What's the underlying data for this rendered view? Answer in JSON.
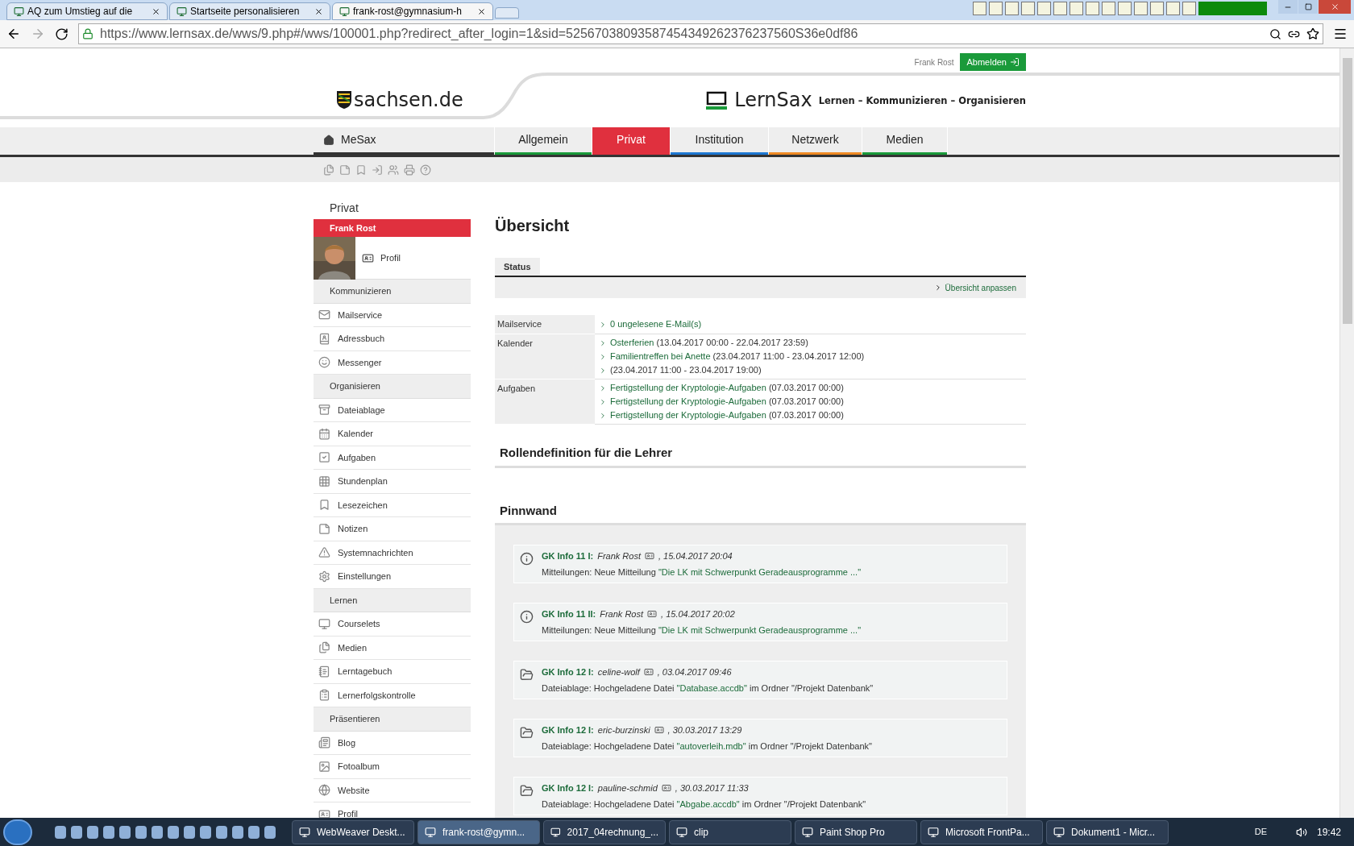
{
  "browser": {
    "tabs": [
      {
        "title": "AQ zum Umstieg auf die",
        "selected": false
      },
      {
        "title": "Startseite personalisieren",
        "selected": false
      },
      {
        "title": "frank-rost@gymnasium-h",
        "selected": true
      }
    ],
    "url": "https://www.lernsax.de/wws/9.php#/wws/100001.php?redirect_after_login=1&sid=52567038093587454349262376237560S36e0df86"
  },
  "header": {
    "user": "Frank Rost",
    "logout": "Abmelden",
    "state_logo": "sachsen.de",
    "brand": "LernSax",
    "slogan": "Lernen – Kommunizieren – Organisieren"
  },
  "nav": [
    {
      "label": "MeSax",
      "color": "#333333",
      "selected": false
    },
    {
      "label": "Allgemein",
      "color": "#1a9a3a",
      "selected": false
    },
    {
      "label": "Privat",
      "color": "#e0303e",
      "selected": true
    },
    {
      "label": "Institution",
      "color": "#1e78d2",
      "selected": false
    },
    {
      "label": "Netzwerk",
      "color": "#f08a24",
      "selected": false
    },
    {
      "label": "Medien",
      "color": "#1a9a3a",
      "selected": false
    }
  ],
  "sidebar": {
    "title": "Privat",
    "user": "Frank Rost",
    "profile": "Profil",
    "sections": [
      {
        "heading": "Kommunizieren",
        "items": [
          "Mailservice",
          "Adressbuch",
          "Messenger"
        ]
      },
      {
        "heading": "Organisieren",
        "items": [
          "Dateiablage",
          "Kalender",
          "Aufgaben",
          "Stundenplan",
          "Lesezeichen",
          "Notizen",
          "Systemnachrichten",
          "Einstellungen"
        ]
      },
      {
        "heading": "Lernen",
        "items": [
          "Courselets",
          "Medien",
          "Lerntagebuch",
          "Lernerfolgskontrolle"
        ]
      },
      {
        "heading": "Präsentieren",
        "items": [
          "Blog",
          "Fotoalbum",
          "Website",
          "Profil"
        ]
      }
    ]
  },
  "main": {
    "title": "Übersicht",
    "tab": "Status",
    "customize": "Übersicht anpassen",
    "status": [
      {
        "label": "Mailservice",
        "entries": [
          {
            "link": "0 ungelesene E-Mail(s)"
          }
        ]
      },
      {
        "label": "Kalender",
        "entries": [
          {
            "link": "Osterferien",
            "detail": "(13.04.2017 00:00 - 22.04.2017 23:59)"
          },
          {
            "link": "Familientreffen bei Anette",
            "detail": "(23.04.2017 11:00 - 23.04.2017 12:00)"
          },
          {
            "detail": "(23.04.2017 11:00 - 23.04.2017 19:00)"
          }
        ]
      },
      {
        "label": "Aufgaben",
        "entries": [
          {
            "link": "Fertigstellung der Kryptologie-Aufgaben",
            "detail": "(07.03.2017 00:00)"
          },
          {
            "link": "Fertigstellung der Kryptologie-Aufgaben",
            "detail": "(07.03.2017 00:00)"
          },
          {
            "link": "Fertigstellung der Kryptologie-Aufgaben",
            "detail": "(07.03.2017 00:00)"
          }
        ]
      }
    ],
    "roles_title": "Rollendefinition für die Lehrer",
    "board_title": "Pinnwand",
    "board": [
      {
        "kind": "info",
        "group": "GK Info 11 I:",
        "author": "Frank Rost",
        "date": ", 15.04.2017 20:04",
        "prefix": "Mitteilungen: Neue Mitteilung ",
        "link": "\"Die LK mit Schwerpunkt Geradeausprogramme ...\""
      },
      {
        "kind": "info",
        "group": "GK Info 11 II:",
        "author": "Frank Rost",
        "date": ", 15.04.2017 20:02",
        "prefix": "Mitteilungen: Neue Mitteilung ",
        "link": "\"Die LK mit Schwerpunkt Geradeausprogramme ...\""
      },
      {
        "kind": "file",
        "group": "GK Info 12 I:",
        "author": "celine-wolf",
        "date": ", 03.04.2017 09:46",
        "prefix": "Dateiablage: Hochgeladene Datei ",
        "link": "\"Database.accdb\"",
        "suffix": " im Ordner \"/Projekt Datenbank\""
      },
      {
        "kind": "file",
        "group": "GK Info 12 I:",
        "author": "eric-burzinski",
        "date": ", 30.03.2017 13:29",
        "prefix": "Dateiablage: Hochgeladene Datei ",
        "link": "\"autoverleih.mdb\"",
        "suffix": " im Ordner \"/Projekt Datenbank\""
      },
      {
        "kind": "file",
        "group": "GK Info 12 I:",
        "author": "pauline-schmid",
        "date": ", 30.03.2017 11:33",
        "prefix": "Dateiablage: Hochgeladene Datei ",
        "link": "\"Abgabe.accdb\"",
        "suffix": " im Ordner \"/Projekt Datenbank\""
      }
    ]
  },
  "taskbar": {
    "windows": [
      {
        "title": "WebWeaver Deskt...",
        "selected": false
      },
      {
        "title": "frank-rost@gymn...",
        "selected": true
      },
      {
        "title": "2017_04rechnung_...",
        "selected": false
      },
      {
        "title": "clip",
        "selected": false
      },
      {
        "title": "Paint Shop Pro",
        "selected": false
      },
      {
        "title": "Microsoft FrontPa...",
        "selected": false
      },
      {
        "title": "Dokument1 - Micr...",
        "selected": false
      }
    ],
    "language": "DE",
    "time": "19:42"
  }
}
